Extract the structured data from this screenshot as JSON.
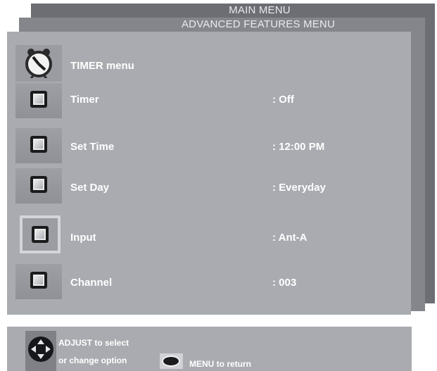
{
  "layers": {
    "main_menu": "MAIN MENU",
    "advanced_menu": "ADVANCED FEATURES MENU"
  },
  "timer_menu": {
    "title": "TIMER menu",
    "rows": [
      {
        "label": "Timer",
        "value": ": Off"
      },
      {
        "label": "Set Time",
        "value": ": 12:00 PM"
      },
      {
        "label": "Set Day",
        "value": ": Everyday"
      },
      {
        "label": "Input",
        "value": ": Ant-A"
      },
      {
        "label": "Channel",
        "value": ": 003"
      }
    ],
    "selected_row": "Input"
  },
  "help": {
    "adjust_line1": "ADJUST to select",
    "adjust_line2": "or change option",
    "menu_return": "MENU to return"
  },
  "icons": {
    "header": "alarm-clock-icon",
    "row": "square-button-icon",
    "dpad": "directional-pad-icon",
    "menu": "menu-button-icon"
  },
  "colors": {
    "main_layer": "#6c6e73",
    "advanced_layer": "#84868b",
    "timer_panel": "#a9abb0",
    "text": "#ffffff"
  }
}
